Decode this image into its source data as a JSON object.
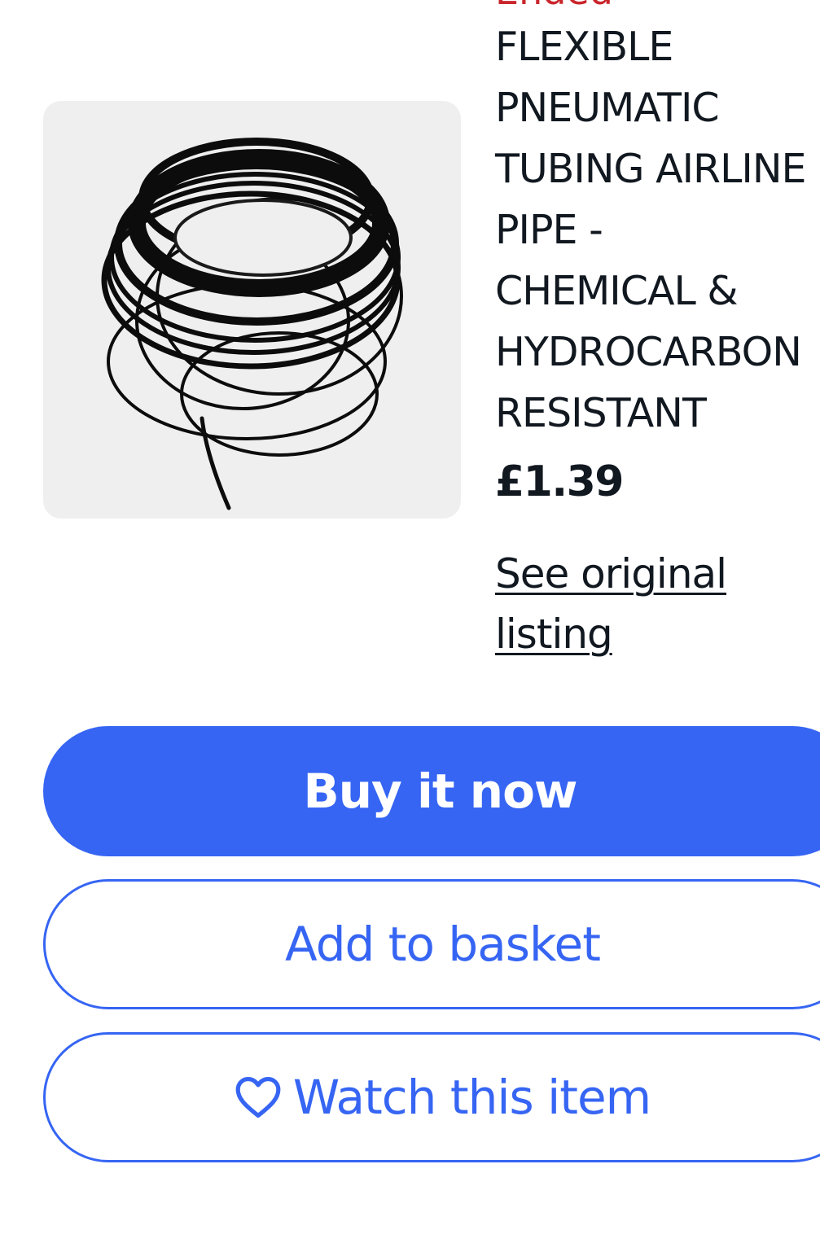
{
  "listing": {
    "status_label": "Ended",
    "title_lines": [
      "FLEXIBLE",
      "PNEUMATIC",
      "TUBING AIRLINE",
      "PIPE -",
      "CHEMICAL &",
      "HYDROCARBON",
      "RESISTANT"
    ],
    "price": "£1.39",
    "original_link": "See original listing",
    "image_subject": "coiled black pneumatic tubing"
  },
  "actions": {
    "buy_label": "Buy it now",
    "basket_label": "Add to basket",
    "watch_label": "Watch this item"
  },
  "icons": {
    "watch": "heart-outline-icon"
  },
  "colors": {
    "accent": "#3665f3",
    "status": "#c9262c",
    "text": "#111820",
    "thumb_background": "#efefef"
  }
}
